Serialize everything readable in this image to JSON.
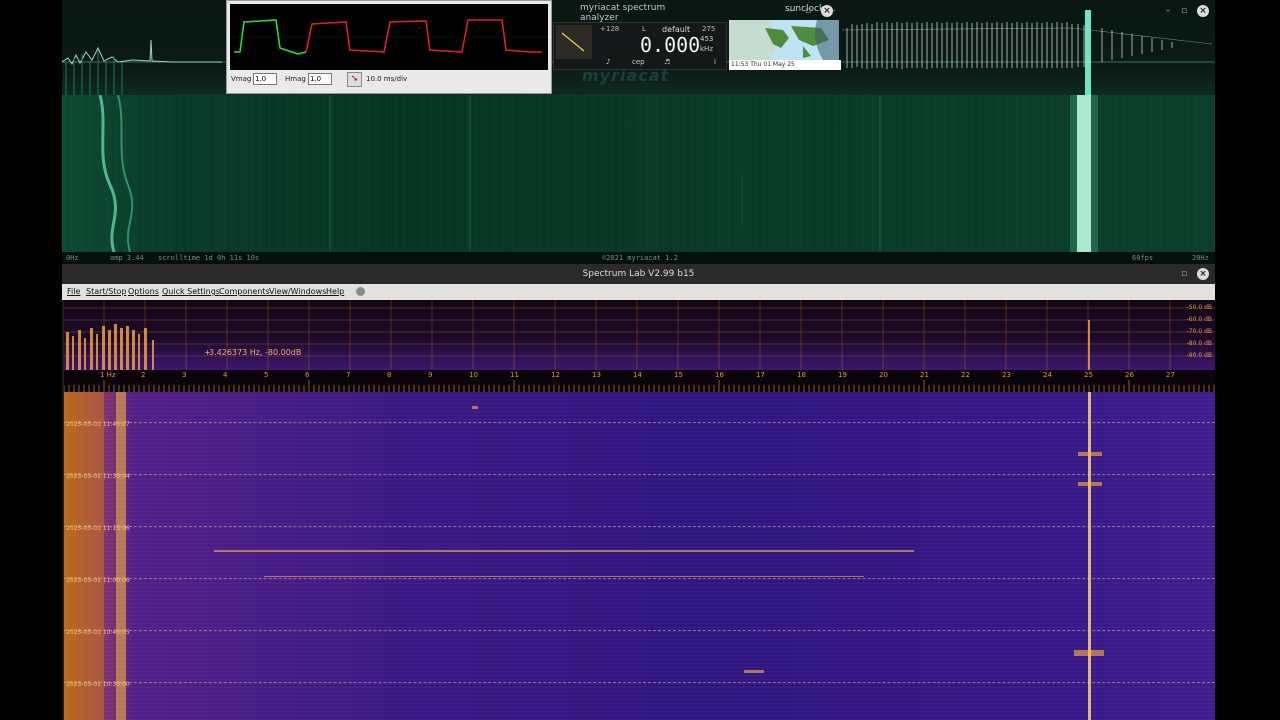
{
  "myriacat": {
    "title": "myriacat spectrum analyzer",
    "brand": "myriacat",
    "watermark": "©2021 myriacat 1.2",
    "status_left": "0Hz",
    "status_amp": "amp 3.44",
    "status_scroll": "scrolltime 1d 0h 11s 10s",
    "status_fps": "60fps",
    "status_right": "20Hz",
    "scope": {
      "vmag_label": "Vmag",
      "vmag_value": "1.0",
      "hmag_label": "Hmag",
      "hmag_value": "1.0",
      "timebase": "10.0 ms/div"
    },
    "readout": {
      "top_left": "+128",
      "top_mid": "L",
      "preset": "default",
      "top_right": "275",
      "side_value": "453",
      "freq": "0.000",
      "unit": "kHz",
      "button_a": "♪",
      "button_b": "cep",
      "button_c": "♬",
      "info": "i"
    }
  },
  "sunclock": {
    "title": "sunclock ...",
    "time": "11:53 Thu 01 May 25"
  },
  "spectrumlab": {
    "title": "Spectrum Lab V2.99 b15",
    "menu": [
      "File",
      "Start/Stop",
      "Options",
      "Quick Settings",
      "Components",
      "View/Windows",
      "Help"
    ],
    "cursor_readout": "3.426373 Hz, -80.00dB",
    "freq_ticks": [
      "1 Hz",
      "2",
      "3",
      "4",
      "5",
      "6",
      "7",
      "8",
      "9",
      "10",
      "11",
      "12",
      "13",
      "14",
      "15",
      "16",
      "17",
      "18",
      "19",
      "20",
      "21",
      "22",
      "23",
      "24",
      "25",
      "26",
      "27"
    ],
    "db_labels": [
      "-50.0 dB",
      "-60.0 dB",
      "-70.0 dB",
      "-80.0 dB",
      "-90.0 dB"
    ],
    "timestamps": [
      "2025-05-01 11:45:07",
      "2025-05-01 11:30:04",
      "2025-05-01 11:15:06",
      "2025-05-01 11:00:06",
      "2025-05-01 10:45:05",
      "2025-05-01 10:30:00"
    ]
  },
  "colors": {
    "accent_green": "#39e0a0",
    "waterfall_orange": "#ffb347",
    "waterfall_purple": "#3a1a86",
    "scope_green": "#28e028",
    "scope_red": "#e02020"
  }
}
